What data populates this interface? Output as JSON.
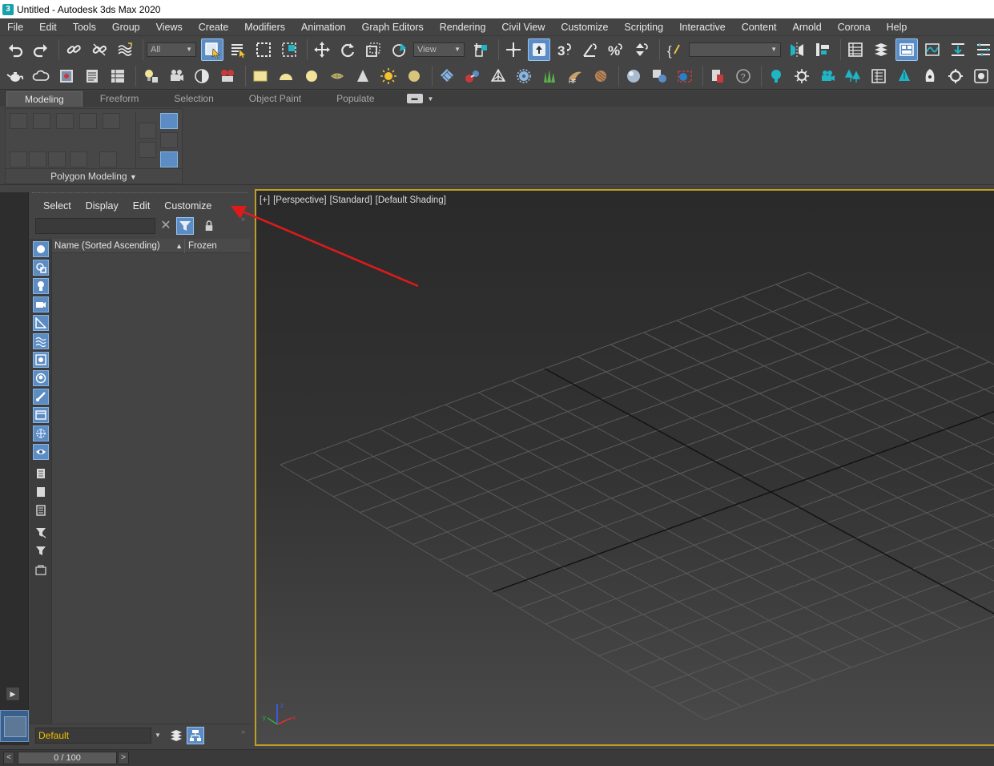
{
  "window": {
    "title": "Untitled - Autodesk 3ds Max 2020"
  },
  "menubar": {
    "items": [
      "File",
      "Edit",
      "Tools",
      "Group",
      "Views",
      "Create",
      "Modifiers",
      "Animation",
      "Graph Editors",
      "Rendering",
      "Civil View",
      "Customize",
      "Scripting",
      "Interactive",
      "Content",
      "Arnold",
      "Corona",
      "Help"
    ]
  },
  "toolbar": {
    "selection_filter": "All",
    "reference_coord": "View",
    "named_selection": ""
  },
  "ribbon": {
    "tabs": [
      "Modeling",
      "Freeform",
      "Selection",
      "Object Paint",
      "Populate"
    ],
    "active_tab": "Modeling",
    "panel_label": "Polygon Modeling"
  },
  "scene_explorer": {
    "menu": [
      "Select",
      "Display",
      "Edit",
      "Customize"
    ],
    "search_value": "",
    "columns": {
      "name": "Name (Sorted Ascending)",
      "frozen": "Frozen"
    },
    "layer": "Default",
    "tool_icons": [
      "geometry-icon",
      "shapes-icon",
      "lights-icon",
      "cameras-icon",
      "helpers-icon",
      "space-warps-icon",
      "groups-icon",
      "xrefs-icon",
      "bones-icon",
      "containers-icon",
      "particles-icon",
      "display-all-icon",
      "display-none-icon",
      "invert-display-icon",
      "invert-filter-icon",
      "filter-icon",
      "find-icon"
    ]
  },
  "viewport": {
    "labels": [
      "[+]",
      "[Perspective]",
      "[Standard]",
      "[Default Shading]"
    ],
    "border_color": "#c09e25"
  },
  "timeline": {
    "frame_display": "0 / 100",
    "prev": "<",
    "next": ">"
  },
  "colors": {
    "accent_blue": "#5b8cc4",
    "layer_text": "#f0c000",
    "annotation_arrow": "#e01a1a"
  }
}
